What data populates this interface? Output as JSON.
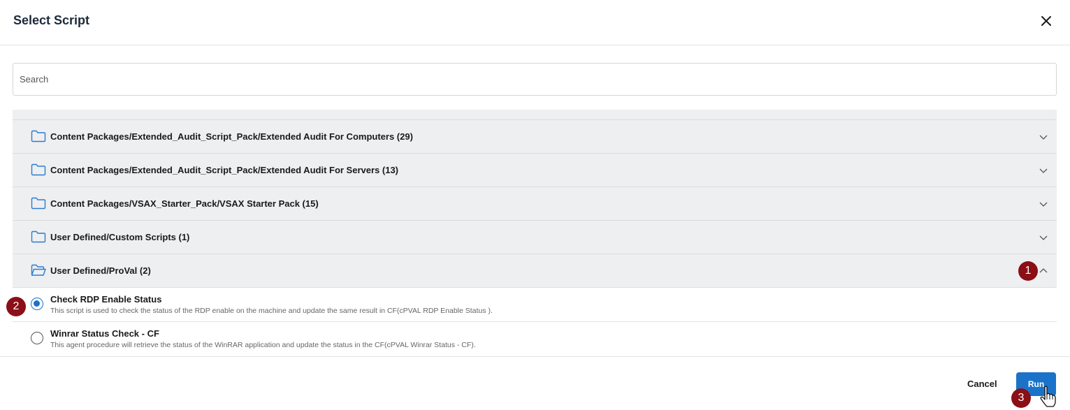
{
  "dialog": {
    "title": "Select Script"
  },
  "search": {
    "placeholder": "Search",
    "value": ""
  },
  "folders": [
    {
      "label": "Content Packages/Extended_Audit_Script_Pack/Extended Audit For Computers (29)",
      "expanded": false
    },
    {
      "label": "Content Packages/Extended_Audit_Script_Pack/Extended Audit For Servers (13)",
      "expanded": false
    },
    {
      "label": "Content Packages/VSAX_Starter_Pack/VSAX Starter Pack (15)",
      "expanded": false
    },
    {
      "label": "User Defined/Custom Scripts (1)",
      "expanded": false
    },
    {
      "label": "User Defined/ProVal (2)",
      "expanded": true
    }
  ],
  "scripts": [
    {
      "name": "Check RDP Enable Status",
      "description": "This script is used to check the status of the RDP enable on the machine and update the same result in CF(cPVAL RDP Enable Status ).",
      "selected": true
    },
    {
      "name": "Winrar Status Check - CF",
      "description": "This agent procedure will retrieve the status of the WinRAR application and update the status in the CF(cPVAL Winrar Status - CF).",
      "selected": false
    }
  ],
  "footer": {
    "cancel_label": "Cancel",
    "run_label": "Run"
  },
  "annotations": {
    "step1": "1",
    "step2": "2",
    "step3": "3"
  },
  "colors": {
    "accent": "#1a73c9",
    "annotation": "#8b0f16",
    "folder_icon": "#2b7bd0"
  },
  "icons": {
    "close": "close-icon",
    "folder": "folder-icon",
    "folder_open": "folder-open-icon",
    "chevron_down": "chevron-down-icon",
    "chevron_up": "chevron-up-icon",
    "cursor": "hand-cursor-icon"
  }
}
